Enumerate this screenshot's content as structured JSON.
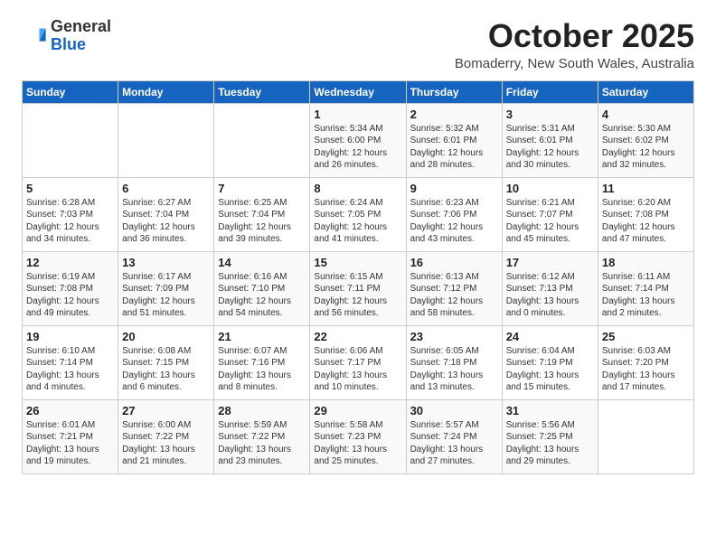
{
  "logo": {
    "general": "General",
    "blue": "Blue"
  },
  "header": {
    "month": "October 2025",
    "location": "Bomaderry, New South Wales, Australia"
  },
  "days_of_week": [
    "Sunday",
    "Monday",
    "Tuesday",
    "Wednesday",
    "Thursday",
    "Friday",
    "Saturday"
  ],
  "weeks": [
    [
      {
        "day": "",
        "info": ""
      },
      {
        "day": "",
        "info": ""
      },
      {
        "day": "",
        "info": ""
      },
      {
        "day": "1",
        "info": "Sunrise: 5:34 AM\nSunset: 6:00 PM\nDaylight: 12 hours\nand 26 minutes."
      },
      {
        "day": "2",
        "info": "Sunrise: 5:32 AM\nSunset: 6:01 PM\nDaylight: 12 hours\nand 28 minutes."
      },
      {
        "day": "3",
        "info": "Sunrise: 5:31 AM\nSunset: 6:01 PM\nDaylight: 12 hours\nand 30 minutes."
      },
      {
        "day": "4",
        "info": "Sunrise: 5:30 AM\nSunset: 6:02 PM\nDaylight: 12 hours\nand 32 minutes."
      }
    ],
    [
      {
        "day": "5",
        "info": "Sunrise: 6:28 AM\nSunset: 7:03 PM\nDaylight: 12 hours\nand 34 minutes."
      },
      {
        "day": "6",
        "info": "Sunrise: 6:27 AM\nSunset: 7:04 PM\nDaylight: 12 hours\nand 36 minutes."
      },
      {
        "day": "7",
        "info": "Sunrise: 6:25 AM\nSunset: 7:04 PM\nDaylight: 12 hours\nand 39 minutes."
      },
      {
        "day": "8",
        "info": "Sunrise: 6:24 AM\nSunset: 7:05 PM\nDaylight: 12 hours\nand 41 minutes."
      },
      {
        "day": "9",
        "info": "Sunrise: 6:23 AM\nSunset: 7:06 PM\nDaylight: 12 hours\nand 43 minutes."
      },
      {
        "day": "10",
        "info": "Sunrise: 6:21 AM\nSunset: 7:07 PM\nDaylight: 12 hours\nand 45 minutes."
      },
      {
        "day": "11",
        "info": "Sunrise: 6:20 AM\nSunset: 7:08 PM\nDaylight: 12 hours\nand 47 minutes."
      }
    ],
    [
      {
        "day": "12",
        "info": "Sunrise: 6:19 AM\nSunset: 7:08 PM\nDaylight: 12 hours\nand 49 minutes."
      },
      {
        "day": "13",
        "info": "Sunrise: 6:17 AM\nSunset: 7:09 PM\nDaylight: 12 hours\nand 51 minutes."
      },
      {
        "day": "14",
        "info": "Sunrise: 6:16 AM\nSunset: 7:10 PM\nDaylight: 12 hours\nand 54 minutes."
      },
      {
        "day": "15",
        "info": "Sunrise: 6:15 AM\nSunset: 7:11 PM\nDaylight: 12 hours\nand 56 minutes."
      },
      {
        "day": "16",
        "info": "Sunrise: 6:13 AM\nSunset: 7:12 PM\nDaylight: 12 hours\nand 58 minutes."
      },
      {
        "day": "17",
        "info": "Sunrise: 6:12 AM\nSunset: 7:13 PM\nDaylight: 13 hours\nand 0 minutes."
      },
      {
        "day": "18",
        "info": "Sunrise: 6:11 AM\nSunset: 7:14 PM\nDaylight: 13 hours\nand 2 minutes."
      }
    ],
    [
      {
        "day": "19",
        "info": "Sunrise: 6:10 AM\nSunset: 7:14 PM\nDaylight: 13 hours\nand 4 minutes."
      },
      {
        "day": "20",
        "info": "Sunrise: 6:08 AM\nSunset: 7:15 PM\nDaylight: 13 hours\nand 6 minutes."
      },
      {
        "day": "21",
        "info": "Sunrise: 6:07 AM\nSunset: 7:16 PM\nDaylight: 13 hours\nand 8 minutes."
      },
      {
        "day": "22",
        "info": "Sunrise: 6:06 AM\nSunset: 7:17 PM\nDaylight: 13 hours\nand 10 minutes."
      },
      {
        "day": "23",
        "info": "Sunrise: 6:05 AM\nSunset: 7:18 PM\nDaylight: 13 hours\nand 13 minutes."
      },
      {
        "day": "24",
        "info": "Sunrise: 6:04 AM\nSunset: 7:19 PM\nDaylight: 13 hours\nand 15 minutes."
      },
      {
        "day": "25",
        "info": "Sunrise: 6:03 AM\nSunset: 7:20 PM\nDaylight: 13 hours\nand 17 minutes."
      }
    ],
    [
      {
        "day": "26",
        "info": "Sunrise: 6:01 AM\nSunset: 7:21 PM\nDaylight: 13 hours\nand 19 minutes."
      },
      {
        "day": "27",
        "info": "Sunrise: 6:00 AM\nSunset: 7:22 PM\nDaylight: 13 hours\nand 21 minutes."
      },
      {
        "day": "28",
        "info": "Sunrise: 5:59 AM\nSunset: 7:22 PM\nDaylight: 13 hours\nand 23 minutes."
      },
      {
        "day": "29",
        "info": "Sunrise: 5:58 AM\nSunset: 7:23 PM\nDaylight: 13 hours\nand 25 minutes."
      },
      {
        "day": "30",
        "info": "Sunrise: 5:57 AM\nSunset: 7:24 PM\nDaylight: 13 hours\nand 27 minutes."
      },
      {
        "day": "31",
        "info": "Sunrise: 5:56 AM\nSunset: 7:25 PM\nDaylight: 13 hours\nand 29 minutes."
      },
      {
        "day": "",
        "info": ""
      }
    ]
  ]
}
